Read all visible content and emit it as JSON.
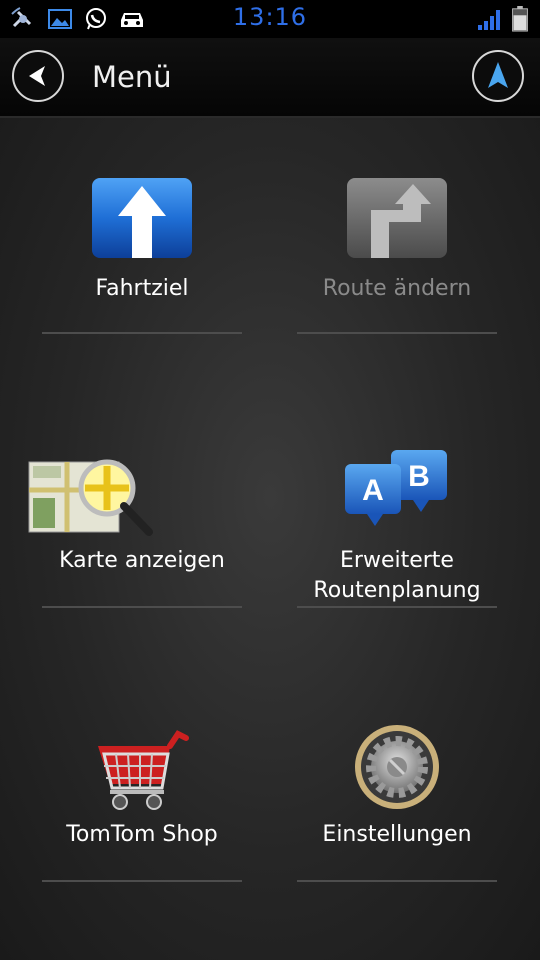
{
  "status_bar": {
    "time": "13:16",
    "icons": [
      "satellite-icon",
      "gallery-icon",
      "whatsapp-icon",
      "car-icon",
      "signal-icon",
      "battery-icon"
    ]
  },
  "header": {
    "title": "Menü",
    "back_icon": "back-arrow-icon",
    "nav_icon": "navigation-arrow-icon"
  },
  "menu": {
    "items": [
      {
        "label": "Fahrtziel",
        "icon": "go-arrow-icon",
        "enabled": true
      },
      {
        "label": "Route ändern",
        "icon": "change-route-icon",
        "enabled": false
      },
      {
        "label": "Karte anzeigen",
        "icon": "map-magnifier-icon",
        "enabled": true
      },
      {
        "label_line1": "Erweiterte",
        "label_line2": "Routenplanung",
        "icon": "ab-planning-icon",
        "enabled": true
      },
      {
        "label": "TomTom Shop",
        "icon": "shopping-cart-icon",
        "enabled": true
      },
      {
        "label": "Einstellungen",
        "icon": "settings-gear-icon",
        "enabled": true
      }
    ]
  },
  "colors": {
    "accent_blue": "#2f6fe8",
    "time_color": "#2f6fe8",
    "disabled_text": "#8a8a8a"
  }
}
